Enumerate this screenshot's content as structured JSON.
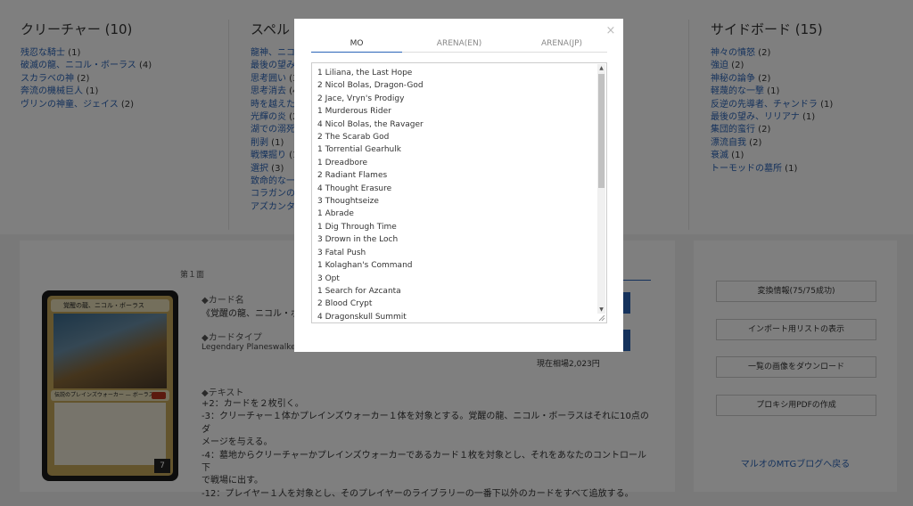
{
  "columns": {
    "creatures": {
      "title": "クリーチャー (10)",
      "items": [
        {
          "name": "残忍な騎士",
          "count": "(1)"
        },
        {
          "name": "破滅の龍、ニコル・ボーラス",
          "count": "(4)"
        },
        {
          "name": "スカラベの神",
          "count": "(2)"
        },
        {
          "name": "奔流の機械巨人",
          "count": "(1)"
        },
        {
          "name": "ヴリンの神童、ジェイス",
          "count": "(2)"
        }
      ]
    },
    "spells": {
      "title": "スペル",
      "items": [
        {
          "name": "龍神、ニコ"
        },
        {
          "name": "最後の望み"
        },
        {
          "name": "思考囲い",
          "count": "(3"
        },
        {
          "name": "思考消去",
          "count": "(4"
        },
        {
          "name": "時を越えた"
        },
        {
          "name": "光輝の炎",
          "count": "(2"
        },
        {
          "name": "湖での溺死"
        },
        {
          "name": "削剥",
          "count": "(1)"
        },
        {
          "name": "戦慄掘り",
          "count": "(1"
        },
        {
          "name": "選択",
          "count": "(3)"
        },
        {
          "name": "致命的な一"
        },
        {
          "name": "コラガンの"
        },
        {
          "name": "アズカンタ"
        }
      ]
    },
    "sideboard": {
      "title": "サイドボード (15)",
      "items": [
        {
          "name": "神々の憤怒",
          "count": "(2)"
        },
        {
          "name": "強迫",
          "count": "(2)"
        },
        {
          "name": "神秘の論争",
          "count": "(2)"
        },
        {
          "name": "軽蔑的な一撃",
          "count": "(1)"
        },
        {
          "name": "反逆の先導者、チャンドラ",
          "count": "(1)"
        },
        {
          "name": "最後の望み、リリアナ",
          "count": "(1)"
        },
        {
          "name": "集団的蛮行",
          "count": "(2)"
        },
        {
          "name": "漂流自我",
          "count": "(2)"
        },
        {
          "name": "衰滅",
          "count": "(1)"
        },
        {
          "name": "トーモッドの墓所",
          "count": "(1)"
        }
      ]
    }
  },
  "detail": {
    "tab_label": "第１面",
    "card_name_head": "◆カード名",
    "card_name": "《覚醒の龍、ニコル・ボ",
    "card_type_head": "◆カードタイプ",
    "card_type": "Legendary Planeswalker",
    "text_head": "◆テキスト",
    "text_lines": [
      "+2：カードを２枚引く。",
      "-3：クリーチャー１体かプレインズウォーカー１体を対象とする。覚醒の龍、ニコル・ボーラスはそれに10点のダ",
      "メージを与える。",
      "-4：墓地からクリーチャーかプレインズウォーカーであるカード１枚を対象とし、それをあなたのコントロール下",
      "で戦場に出す。",
      "-12：プレイヤー１人を対象とし、そのプレイヤーのライブラリーの一番下以外のカードをすべて追放する。"
    ],
    "price": "現在相場2,023円",
    "card": {
      "title": "覚醒の龍、ニコル・ボーラス",
      "type_line": "伝説のプレインズウォーカー — ボーラス",
      "loyalty": "7"
    }
  },
  "sidebar": {
    "buttons": [
      "変換情報(75/75成功)",
      "インポート用リストの表示",
      "一覧の画像をダウンロード",
      "プロキシ用PDFの作成"
    ],
    "link": "マルオのMTGブログへ戻る"
  },
  "modal": {
    "close": "×",
    "tabs": [
      "MO",
      "ARENA(EN)",
      "ARENA(JP)"
    ],
    "active_tab": "MO",
    "deck_list": [
      "1 Liliana, the Last Hope",
      "2 Nicol Bolas, Dragon-God",
      "2 Jace, Vryn's Prodigy",
      "1 Murderous Rider",
      "4 Nicol Bolas, the Ravager",
      "2 The Scarab God",
      "1 Torrential Gearhulk",
      "1 Dreadbore",
      "2 Radiant Flames",
      "4 Thought Erasure",
      "3 Thoughtseize",
      "1 Abrade",
      "1 Dig Through Time",
      "3 Drown in the Loch",
      "3 Fatal Push",
      "1 Kolaghan's Command",
      "3 Opt",
      "1 Search for Azcanta",
      "2 Blood Crypt",
      "4 Dragonskull Summit"
    ]
  },
  "colors": {
    "link": "#2a64b8",
    "overlay": "rgba(0,0,0,0.5)"
  }
}
